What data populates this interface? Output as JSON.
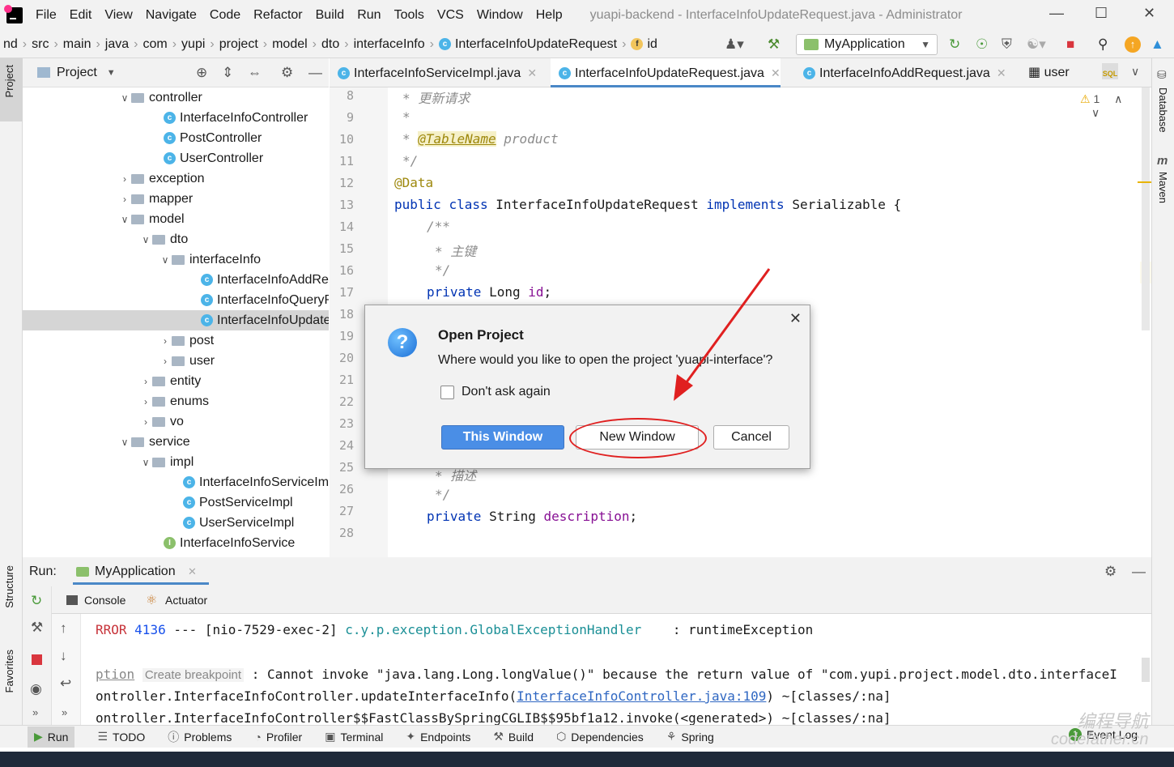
{
  "app": {
    "menu": [
      "File",
      "Edit",
      "View",
      "Navigate",
      "Code",
      "Refactor",
      "Build",
      "Run",
      "Tools",
      "VCS",
      "Window",
      "Help"
    ],
    "title": "yuapi-backend - InterfaceInfoUpdateRequest.java - Administrator"
  },
  "breadcrumb": [
    "nd",
    "src",
    "main",
    "java",
    "com",
    "yupi",
    "project",
    "model",
    "dto",
    "interfaceInfo",
    "InterfaceInfoUpdateRequest",
    "id"
  ],
  "toolbar": {
    "run_config": "MyApplication"
  },
  "project_panel": {
    "title": "Project",
    "side_label": "Project",
    "tree": [
      {
        "label": "controller",
        "indent": 1,
        "type": "folder",
        "expanded": true
      },
      {
        "label": "InterfaceInfoController",
        "indent": 2,
        "type": "class"
      },
      {
        "label": "PostController",
        "indent": 2,
        "type": "class"
      },
      {
        "label": "UserController",
        "indent": 2,
        "type": "class"
      },
      {
        "label": "exception",
        "indent": 1,
        "type": "folder",
        "expanded": false
      },
      {
        "label": "mapper",
        "indent": 1,
        "type": "folder",
        "expanded": false
      },
      {
        "label": "model",
        "indent": 1,
        "type": "folder",
        "expanded": true
      },
      {
        "label": "dto",
        "indent": 2,
        "type": "folder",
        "expanded": true
      },
      {
        "label": "interfaceInfo",
        "indent": 3,
        "type": "folder",
        "expanded": true
      },
      {
        "label": "InterfaceInfoAddRequest",
        "indent": 4,
        "type": "class"
      },
      {
        "label": "InterfaceInfoQueryRequest",
        "indent": 4,
        "type": "class"
      },
      {
        "label": "InterfaceInfoUpdateRequest",
        "indent": 4,
        "type": "class",
        "selected": true
      },
      {
        "label": "post",
        "indent": 3,
        "type": "folder",
        "expanded": false
      },
      {
        "label": "user",
        "indent": 3,
        "type": "folder",
        "expanded": false
      },
      {
        "label": "entity",
        "indent": 2,
        "type": "folder",
        "expanded": false
      },
      {
        "label": "enums",
        "indent": 2,
        "type": "folder",
        "expanded": false
      },
      {
        "label": "vo",
        "indent": 2,
        "type": "folder",
        "expanded": false
      },
      {
        "label": "service",
        "indent": 1,
        "type": "folder",
        "expanded": true
      },
      {
        "label": "impl",
        "indent": 2,
        "type": "folder",
        "expanded": true
      },
      {
        "label": "InterfaceInfoServiceImpl",
        "indent": 3,
        "type": "class"
      },
      {
        "label": "PostServiceImpl",
        "indent": 3,
        "type": "class"
      },
      {
        "label": "UserServiceImpl",
        "indent": 3,
        "type": "class"
      },
      {
        "label": "InterfaceInfoService",
        "indent": 2,
        "type": "interface"
      }
    ]
  },
  "editor_tabs": [
    {
      "label": "InterfaceInfoServiceImpl.java",
      "active": false
    },
    {
      "label": "InterfaceInfoUpdateRequest.java",
      "active": true
    },
    {
      "label": "InterfaceInfoAddRequest.java",
      "active": false
    },
    {
      "label": "user",
      "active": false
    }
  ],
  "editor": {
    "warning_count": "1",
    "line_numbers": [
      "8",
      "9",
      "10",
      "11",
      "12",
      "13",
      "14",
      "15",
      "16",
      "17",
      "18",
      "19",
      "20",
      "21",
      "22",
      "23",
      "24",
      "25",
      "26",
      "27",
      "28"
    ],
    "lines": {
      "l8": "* 更新请求",
      "l9": "*",
      "l10_star": "*",
      "l10_ann": "@TableName",
      "l10_rest": "product",
      "l11": "*/",
      "l12": "@Data",
      "l13_kw1": "public",
      "l13_kw2": "class",
      "l13_name": "InterfaceInfoUpdateRequest",
      "l13_kw3": "implements",
      "l13_rest": "Serializable {",
      "l14": "/**",
      "l15": "* 主键",
      "l16": "*/",
      "l17_kw": "private",
      "l17_type": "Long",
      "l17_field": "id",
      "l17_end": ";",
      "l25": "* 描述",
      "l26": "*/",
      "l27_kw": "private",
      "l27_type": "String",
      "l27_field": "description",
      "l27_end": ";"
    }
  },
  "right_strip": [
    "Database",
    "Maven"
  ],
  "run_panel": {
    "label": "Run:",
    "config": "MyApplication",
    "tabs": [
      "Console",
      "Actuator"
    ],
    "console": {
      "line1_a": "RROR",
      "line1_num": "4136",
      "line1_b": " --- [nio-7529-exec-2] ",
      "line1_cls": "c.y.p.exception.GlobalExceptionHandler",
      "line1_c": "    : runtimeException",
      "line2_a": "ption",
      "line2_hint": "Create breakpoint",
      "line2_b": " : Cannot invoke \"java.lang.Long.longValue()\" because the return value of \"com.yupi.project.model.dto.interfaceI",
      "line3_a": "ontroller.InterfaceInfoController.updateInterfaceInfo(",
      "line3_link": "InterfaceInfoController.java:109",
      "line3_b": ") ~[classes/:na]",
      "line4": "ontroller.InterfaceInfoController$$FastClassBySpringCGLIB$$95bf1a12.invoke(<generated>) ~[classes/:na]"
    }
  },
  "left_strip_bottom": [
    "Structure",
    "Favorites"
  ],
  "bottom_bar": [
    "Run",
    "TODO",
    "Problems",
    "Profiler",
    "Terminal",
    "Endpoints",
    "Build",
    "Dependencies",
    "Spring"
  ],
  "event_log": {
    "count": "1",
    "label": "Event Log"
  },
  "dialog": {
    "title": "Open Project",
    "message": "Where would you like to open the project 'yuapi-interface'?",
    "checkbox": "Don't ask again",
    "btn_this": "This Window",
    "btn_new": "New Window",
    "btn_cancel": "Cancel"
  },
  "watermark": [
    "编程导航",
    "codefather.cn"
  ]
}
